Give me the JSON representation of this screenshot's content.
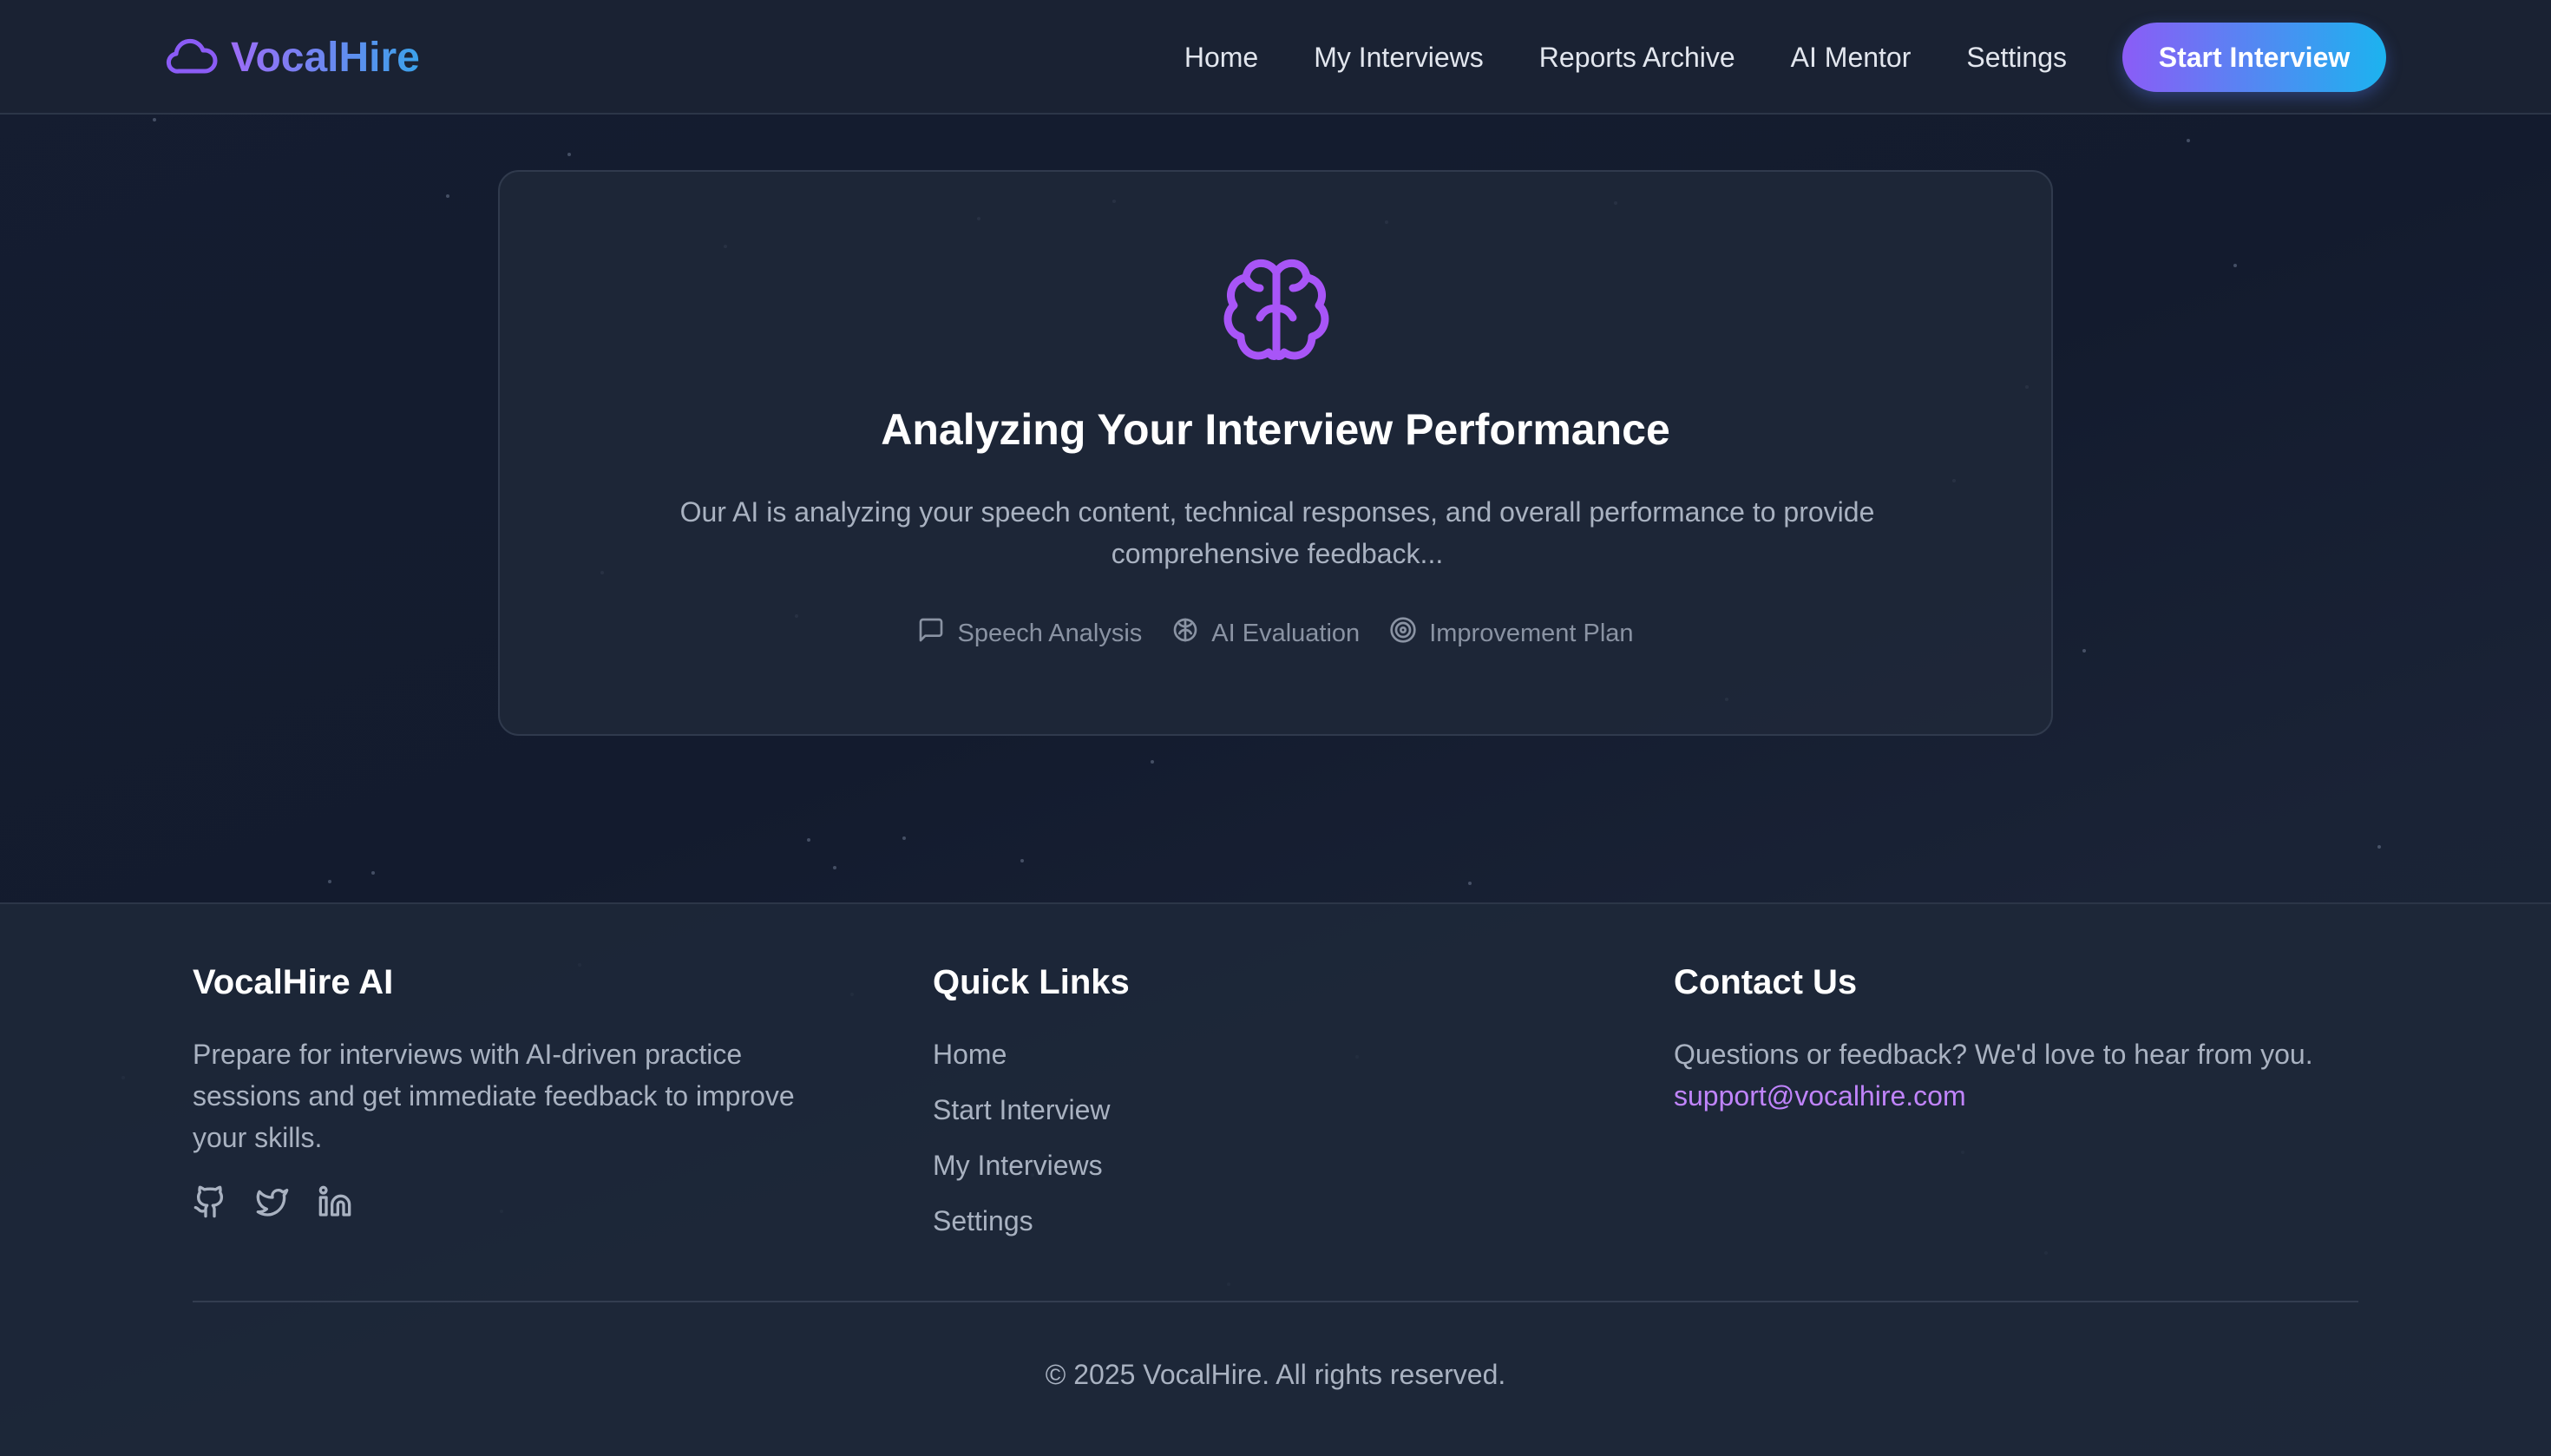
{
  "header": {
    "brand": "VocalHire",
    "nav": [
      "Home",
      "My Interviews",
      "Reports Archive",
      "AI Mentor",
      "Settings"
    ],
    "cta_label": "Start Interview"
  },
  "card": {
    "icon": "brain-icon",
    "title": "Analyzing Your Interview Performance",
    "description": "Our AI is analyzing your speech content, technical responses, and overall performance to provide comprehensive feedback...",
    "features": [
      {
        "icon": "message-square-icon",
        "label": "Speech Analysis"
      },
      {
        "icon": "brain-small-icon",
        "label": "AI Evaluation"
      },
      {
        "icon": "target-icon",
        "label": "Improvement Plan"
      }
    ]
  },
  "footer": {
    "about": {
      "title": "VocalHire AI",
      "text": "Prepare for interviews with AI-driven practice sessions and get immediate feedback to improve your skills.",
      "socials": [
        "github-icon",
        "twitter-icon",
        "linkedin-icon"
      ]
    },
    "quick_links": {
      "title": "Quick Links",
      "items": [
        "Home",
        "Start Interview",
        "My Interviews",
        "Settings"
      ]
    },
    "contact": {
      "title": "Contact Us",
      "text": "Questions or feedback? We'd love to hear from you.",
      "email": "support@vocalhire.com"
    },
    "copyright": "© 2025 VocalHire. All rights reserved."
  },
  "colors": {
    "accent_purple": "#8b5cf6",
    "accent_blue": "#1cb3ef",
    "link_purple": "#c084fc",
    "background": "#151d30"
  }
}
